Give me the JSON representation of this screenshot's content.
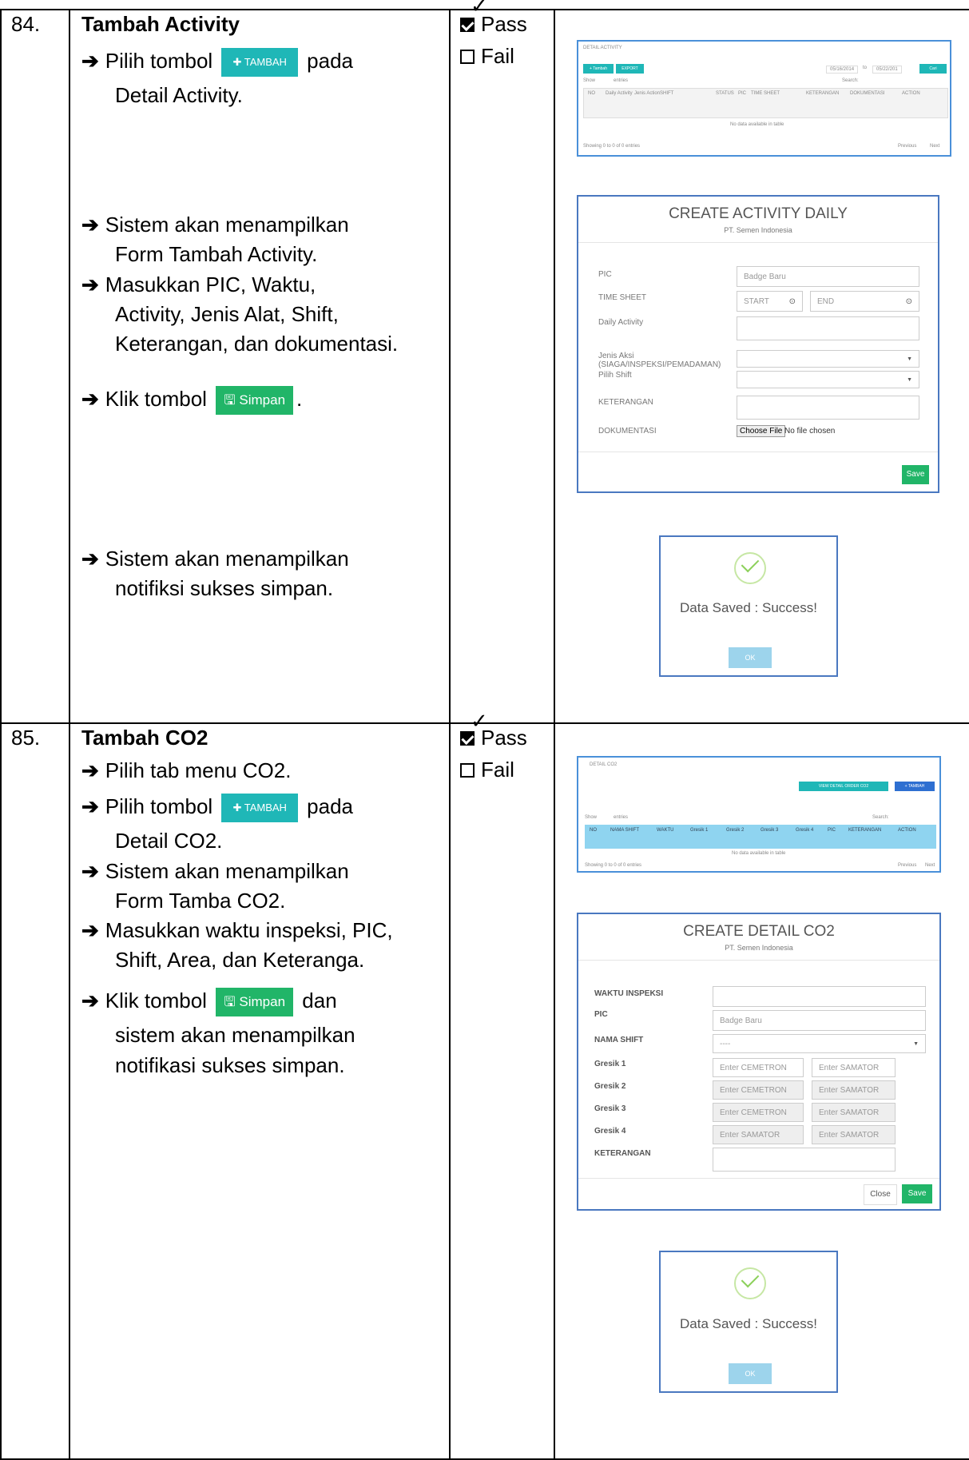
{
  "rows": [
    {
      "number": "84.",
      "title": "Tambah Activity",
      "steps": {
        "s1_a": "Pilih tombol",
        "s1_b": "pada",
        "s1_c": "Detail Activity.",
        "s2_a": "Sistem akan menampilkan",
        "s2_b": "Form Tambah Activity.",
        "s3_a": "Masukkan PIC, Waktu,",
        "s3_b": "Activity, Jenis Alat, Shift,",
        "s3_c": "Keterangan, dan dokumentasi.",
        "s4_a": "Klik tombol",
        "s4_b": ".",
        "s5_a": "Sistem akan menampilkan",
        "s5_b": "notifiksi sukses simpan."
      },
      "pass": "Pass",
      "fail": "Fail"
    },
    {
      "number": "85.",
      "title": "Tambah CO2",
      "steps": {
        "s1": "Pilih tab menu CO2.",
        "s2_a": "Pilih tombol",
        "s2_b": "pada",
        "s2_c": "Detail CO2.",
        "s3_a": "Sistem akan menampilkan",
        "s3_b": "Form Tamba CO2.",
        "s4_a": "Masukkan waktu inspeksi, PIC,",
        "s4_b": "Shift, Area, dan Keteranga.",
        "s5_a": "Klik tombol",
        "s5_b": "dan",
        "s5_c": "sistem akan menampilkan",
        "s5_d": "notifikasi sukses simpan."
      },
      "pass": "Pass",
      "fail": "Fail"
    }
  ],
  "buttons": {
    "tambah": "TAMBAH",
    "simpan": "Simpan"
  },
  "shot_activity": {
    "header": "DETAIL ACTIVITY",
    "btn_tambah": "+ Tambah",
    "btn_export": "EXPORT",
    "date_from": "05/16/2014",
    "date_sep": "to",
    "date_to": "05/22/201",
    "btn_cari": "Cari",
    "show": "Show",
    "entries": "entries",
    "search": "Search:",
    "columns": [
      "NO",
      "Daily Activity",
      "Jenis Action",
      "SHIFT",
      "STATUS",
      "PIC",
      "TIME SHEET",
      "KETERANGAN",
      "DOKUMENTASI",
      "ACTION"
    ],
    "empty": "No data available in table",
    "showing": "Showing 0 to 0 of 0 entries",
    "previous": "Previous",
    "next": "Next"
  },
  "form_activity": {
    "title": "CREATE ACTIVITY DAILY",
    "subtitle": "PT. Semen Indonesia",
    "pic_label": "PIC",
    "pic_placeholder": "Badge Baru",
    "timesheet_label": "TIME SHEET",
    "start": "START",
    "end": "END",
    "daily_label": "Daily Activity",
    "jenis_label_a": "Jenis Aksi",
    "jenis_label_b": "(SIAGA/INSPEKSI/PEMADAMAN)",
    "shift_label": "Pilih Shift",
    "ket_label": "KETERANGAN",
    "dok_label": "DOKUMENTASI",
    "choose_file": "Choose File",
    "no_file": "No file chosen",
    "save": "Save"
  },
  "success_1": {
    "text": "Data Saved : Success!",
    "ok": "OK"
  },
  "shot_co2": {
    "header": "DETAIL CO2",
    "btn_view": "VIEW DETAIL ORDER CO2",
    "btn_tambah": "+ TAMBAH",
    "show": "Show",
    "entries": "entries",
    "search": "Search:",
    "columns": [
      "NO",
      "NAMA SHIFT",
      "WAKTU",
      "Gresik 1",
      "Gresik 2",
      "Gresik 3",
      "Gresik 4",
      "PIC",
      "KETERANGAN",
      "ACTION"
    ],
    "empty": "No data available in table",
    "showing": "Showing 0 to 0 of 0 entries",
    "previous": "Previous",
    "next": "Next"
  },
  "form_co2": {
    "title": "CREATE DETAIL CO2",
    "subtitle": "PT. Semen Indonesia",
    "waktu_label": "WAKTU INSPEKSI",
    "pic_label": "PIC",
    "pic_placeholder": "Badge Baru",
    "shift_label": "NAMA SHIFT",
    "shift_value": "----",
    "g1": "Gresik 1",
    "g2": "Gresik 2",
    "g3": "Gresik 3",
    "g4": "Gresik 4",
    "cemetron": "Enter CEMETRON",
    "samator": "Enter SAMATOR",
    "ket_label": "KETERANGAN",
    "close": "Close",
    "save": "Save"
  },
  "success_2": {
    "text": "Data Saved : Success!",
    "ok": "OK"
  }
}
